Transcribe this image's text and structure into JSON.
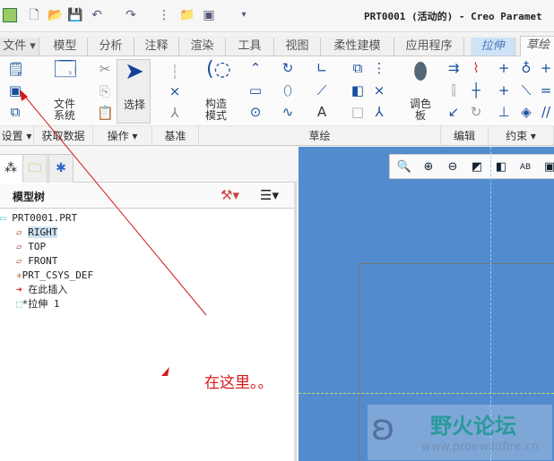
{
  "window": {
    "title": "PRT0001 (活动的) - Creo Paramet"
  },
  "tabs": [
    {
      "label": "文件 ▾"
    },
    {
      "label": "模型"
    },
    {
      "label": "分析"
    },
    {
      "label": "注释"
    },
    {
      "label": "渲染"
    },
    {
      "label": "工具"
    },
    {
      "label": "视图"
    },
    {
      "label": "柔性建模"
    },
    {
      "label": "应用程序"
    },
    {
      "label": "拉伸"
    },
    {
      "label": "草绘"
    }
  ],
  "ribbon": {
    "file_system": "文件\n系统",
    "select": "选择",
    "construction": "构造\n模式",
    "palette": "调色\n板"
  },
  "groups": [
    {
      "label": "设置 ▾"
    },
    {
      "label": "获取数据"
    },
    {
      "label": "操作 ▾"
    },
    {
      "label": "基准"
    },
    {
      "label": "草绘"
    },
    {
      "label": "编辑"
    },
    {
      "label": "约束 ▾"
    }
  ],
  "panel": {
    "title": "模型树",
    "tree": [
      {
        "label": "PRT0001.PRT"
      },
      {
        "label": "RIGHT"
      },
      {
        "label": "TOP"
      },
      {
        "label": "FRONT"
      },
      {
        "label": "PRT_CSYS_DEF"
      },
      {
        "label": "在此插入"
      },
      {
        "label": "*拉伸 1"
      }
    ]
  },
  "annotation": {
    "text": "在这里。。",
    "color": "#e02020"
  },
  "watermark": {
    "name": "野火论坛",
    "url": "www.proewildfire.cn"
  },
  "colors": {
    "canvas": "#528ccf"
  }
}
